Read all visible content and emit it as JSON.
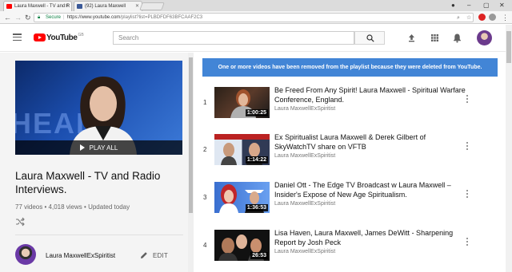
{
  "browser": {
    "tabs": [
      {
        "label": "Laura Maxwell - TV and R"
      },
      {
        "label": "(92) Laura Maxwell"
      }
    ],
    "address": {
      "secure_label": "Secure",
      "url_host": "https://www.youtube.com",
      "url_path": "/playlist?list=PLBDFDF63BFCAAF2C3"
    }
  },
  "header": {
    "logo_text": "YouTube",
    "logo_badge": "GB",
    "search_placeholder": "Search"
  },
  "playlist": {
    "play_all_label": "PLAY ALL",
    "title": "Laura Maxwell - TV and Radio Interviews.",
    "videos_count": "77 videos",
    "views": "4,018 views",
    "updated": "Updated today",
    "stats_separator": "•",
    "owner": "Laura MaxwellExSpiritist",
    "edit_label": "EDIT"
  },
  "notice": "One or more videos have been removed from the playlist because they were deleted from YouTube.",
  "videos": [
    {
      "index": "1",
      "title": "Be Freed From Any Spirit! Laura Maxwell - Spiritual Warfare Conference, England.",
      "channel": "Laura MaxwellExSpiritist",
      "duration": "1:00:25"
    },
    {
      "index": "2",
      "title": "Ex Spiritualist Laura Maxwell & Derek Gilbert of SkyWatchTV share on VFTB",
      "channel": "Laura MaxwellExSpiritist",
      "duration": "1:14:22"
    },
    {
      "index": "3",
      "title": "Daniel Ott - The Edge TV Broadcast w Laura Maxwell – Insider's Expose of New Age Spiritualism.",
      "channel": "Laura MaxwellExSpiritist",
      "duration": "1:36:53"
    },
    {
      "index": "4",
      "title": "Lisa Haven, Laura Maxwell, James DeWitt - Sharpening Report by Josh Peck",
      "channel": "Laura MaxwellExSpiritist",
      "duration": "26:53"
    }
  ],
  "colors": {
    "brand_red": "#ff0000",
    "notice_blue": "#4285d6"
  }
}
